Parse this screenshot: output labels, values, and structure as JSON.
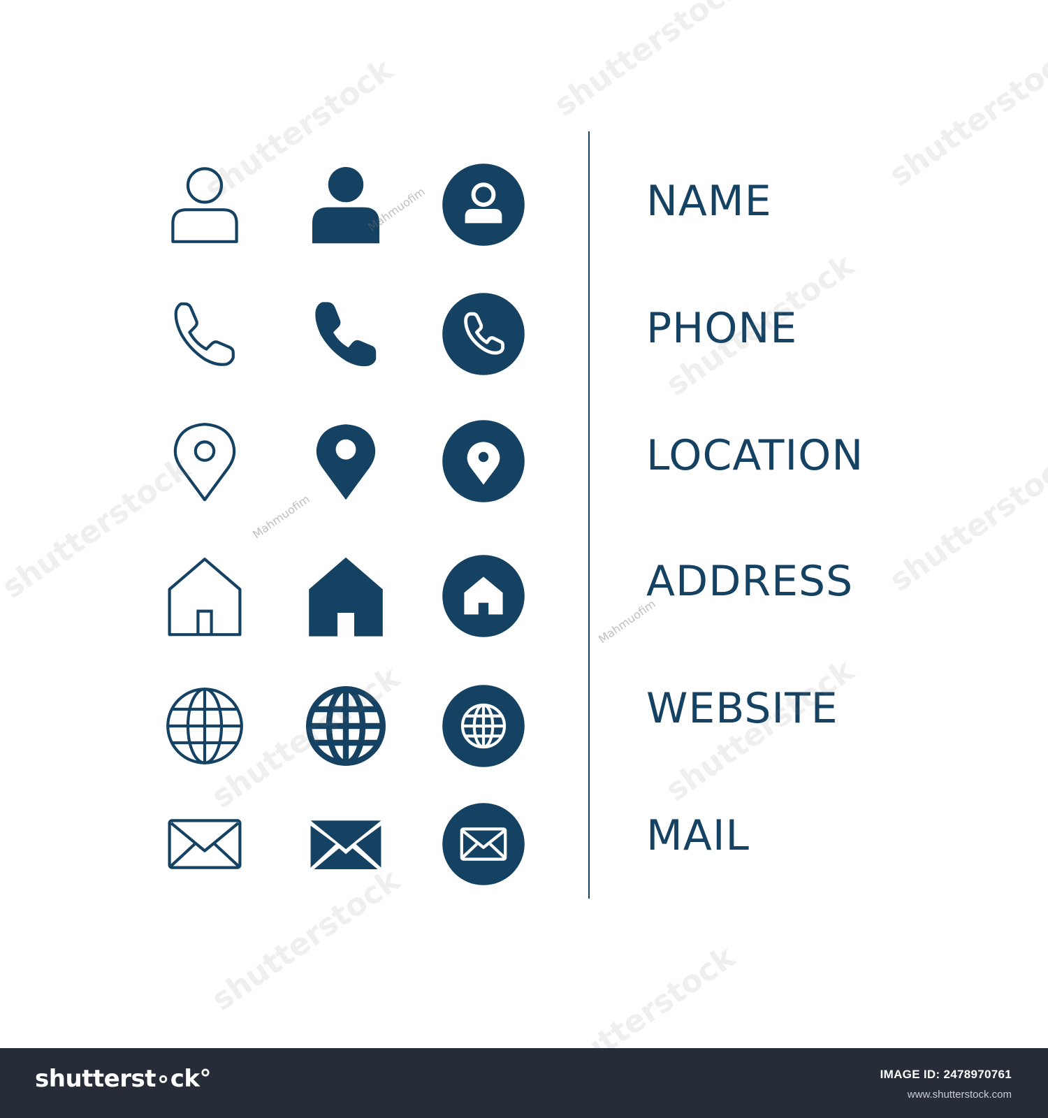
{
  "colors": {
    "icon": "#154263",
    "label": "#154263",
    "divider": "#1b3f5c",
    "footer_bg": "#272d38",
    "background": "#ffffff"
  },
  "rows": [
    {
      "label": "NAME",
      "icon": "person"
    },
    {
      "label": "PHONE",
      "icon": "phone"
    },
    {
      "label": "LOCATION",
      "icon": "location-pin"
    },
    {
      "label": "ADDRESS",
      "icon": "home"
    },
    {
      "label": "WEBSITE",
      "icon": "globe"
    },
    {
      "label": "MAIL",
      "icon": "envelope"
    }
  ],
  "icon_styles": [
    "outline",
    "filled",
    "circle"
  ],
  "watermarks": {
    "stock": "shutterstock",
    "author": "Mahmuofim"
  },
  "footer": {
    "logo": "shutterst∘ck°",
    "image_id": "IMAGE ID: 2478970761",
    "site": "www.shutterstock.com"
  }
}
